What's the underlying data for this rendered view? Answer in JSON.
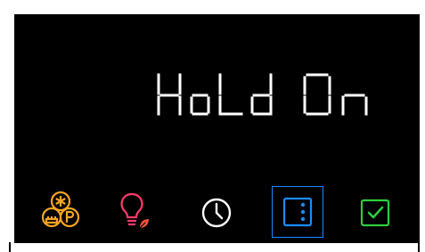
{
  "display": {
    "message": "Hold On",
    "color": "#ffffff"
  },
  "toolbar": {
    "buttons": [
      {
        "id": "mode",
        "icon": "freeze-party-mode-icon",
        "color": "#f5a623"
      },
      {
        "id": "light",
        "icon": "eco-light-bulb-icon",
        "color": "#ff3b6b",
        "leaf_color": "#e8503a"
      },
      {
        "id": "timer",
        "icon": "clock-icon",
        "color": "#ffffff"
      },
      {
        "id": "door",
        "icon": "door-panel-icon",
        "color": "#1a8cff",
        "selected": true
      },
      {
        "id": "confirm",
        "icon": "checkbox-check-icon",
        "color": "#2ecc40"
      }
    ]
  }
}
